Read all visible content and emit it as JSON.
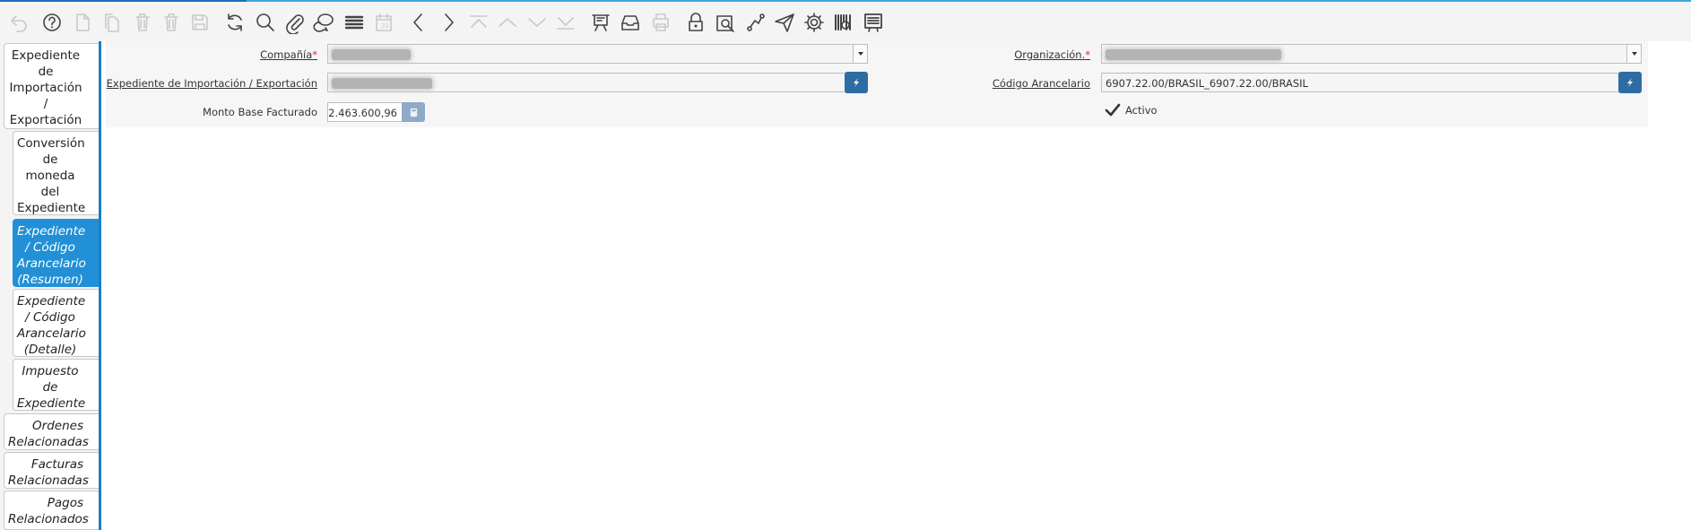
{
  "toolbar": {
    "buttons": [
      {
        "name": "undo-icon",
        "enabled": false
      },
      {
        "name": "help-icon",
        "enabled": true
      },
      {
        "name": "new-record-icon",
        "enabled": false
      },
      {
        "name": "copy-record-icon",
        "enabled": false
      },
      {
        "name": "delete-icon",
        "enabled": false
      },
      {
        "name": "delete-selection-icon",
        "enabled": false
      },
      {
        "name": "save-icon",
        "enabled": false
      },
      {
        "name": "refresh-icon",
        "enabled": true
      },
      {
        "name": "search-icon",
        "enabled": true
      },
      {
        "name": "attachment-icon",
        "enabled": true
      },
      {
        "name": "chat-icon",
        "enabled": true
      },
      {
        "name": "grid-toggle-icon",
        "enabled": true
      },
      {
        "name": "calendar-icon",
        "enabled": false
      },
      {
        "name": "previous-record-icon",
        "enabled": true
      },
      {
        "name": "next-record-icon",
        "enabled": true
      },
      {
        "name": "first-record-icon",
        "enabled": false
      },
      {
        "name": "parent-record-icon",
        "enabled": false
      },
      {
        "name": "child-record-icon",
        "enabled": false
      },
      {
        "name": "last-record-icon",
        "enabled": false
      },
      {
        "name": "report-icon",
        "enabled": true
      },
      {
        "name": "archive-icon",
        "enabled": true
      },
      {
        "name": "print-icon",
        "enabled": false
      },
      {
        "name": "lock-icon",
        "enabled": true
      },
      {
        "name": "zoom-across-icon",
        "enabled": true
      },
      {
        "name": "workflow-icon",
        "enabled": true
      },
      {
        "name": "send-icon",
        "enabled": true
      },
      {
        "name": "process-gear-icon",
        "enabled": true
      },
      {
        "name": "product-info-icon",
        "enabled": true
      },
      {
        "name": "print-document-icon",
        "enabled": true
      }
    ]
  },
  "tabs": [
    {
      "label": "Expediente de Importación / Exportación",
      "level": 0,
      "active": false
    },
    {
      "label": "Conversión de moneda del Expediente",
      "level": 1,
      "active": false
    },
    {
      "label": "Expediente / Código Arancelario (Resumen)",
      "level": 1,
      "active": true
    },
    {
      "label": "Expediente / Código Arancelario (Detalle)",
      "level": 1,
      "active": false
    },
    {
      "label": "Impuesto de Expediente",
      "level": 1,
      "active": false
    },
    {
      "label": "Ordenes Relacionadas",
      "level": 0,
      "active": false
    },
    {
      "label": "Facturas Relacionadas",
      "level": 0,
      "active": false
    },
    {
      "label": "Pagos Relacionados",
      "level": 0,
      "active": false
    }
  ],
  "form": {
    "company": {
      "label": "Compañía",
      "required_mark": "*"
    },
    "organization": {
      "label": "Organización.",
      "required_mark": "*"
    },
    "file": {
      "label": "Expediente de Importación / Exportación"
    },
    "tariff_code": {
      "label": "Código Arancelario",
      "value": "6907.22.00/BRASIL_6907.22.00/BRASIL"
    },
    "base_amount": {
      "label": "Monto Base Facturado",
      "value": "2.463.600,96"
    },
    "active": {
      "label": "Activo",
      "checked": true
    }
  },
  "colors": {
    "accent": "#2190d6",
    "button": "#2e6da4",
    "required": "#d32f2f"
  }
}
